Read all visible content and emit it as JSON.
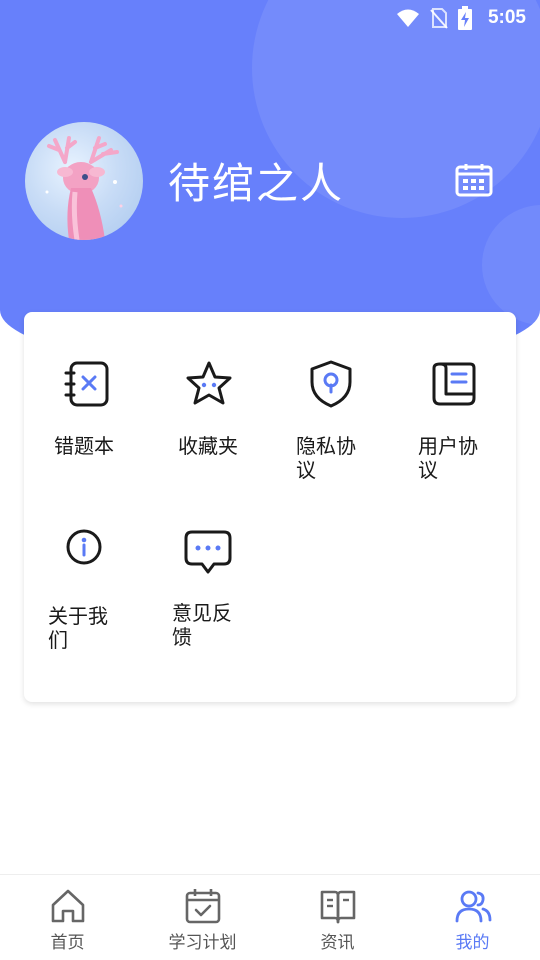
{
  "status_bar": {
    "time": "5:05"
  },
  "profile": {
    "username": "待绾之人"
  },
  "menu": [
    {
      "label": "错题本"
    },
    {
      "label": "收藏夹"
    },
    {
      "label": "隐私协议"
    },
    {
      "label": "用户协议"
    },
    {
      "label": "关于我们"
    },
    {
      "label": "意见反馈"
    }
  ],
  "tabs": [
    {
      "label": "首页"
    },
    {
      "label": "学习计划"
    },
    {
      "label": "资讯"
    },
    {
      "label": "我的"
    }
  ],
  "colors": {
    "primary": "#6780fb",
    "active_tab": "#5a7af5"
  }
}
